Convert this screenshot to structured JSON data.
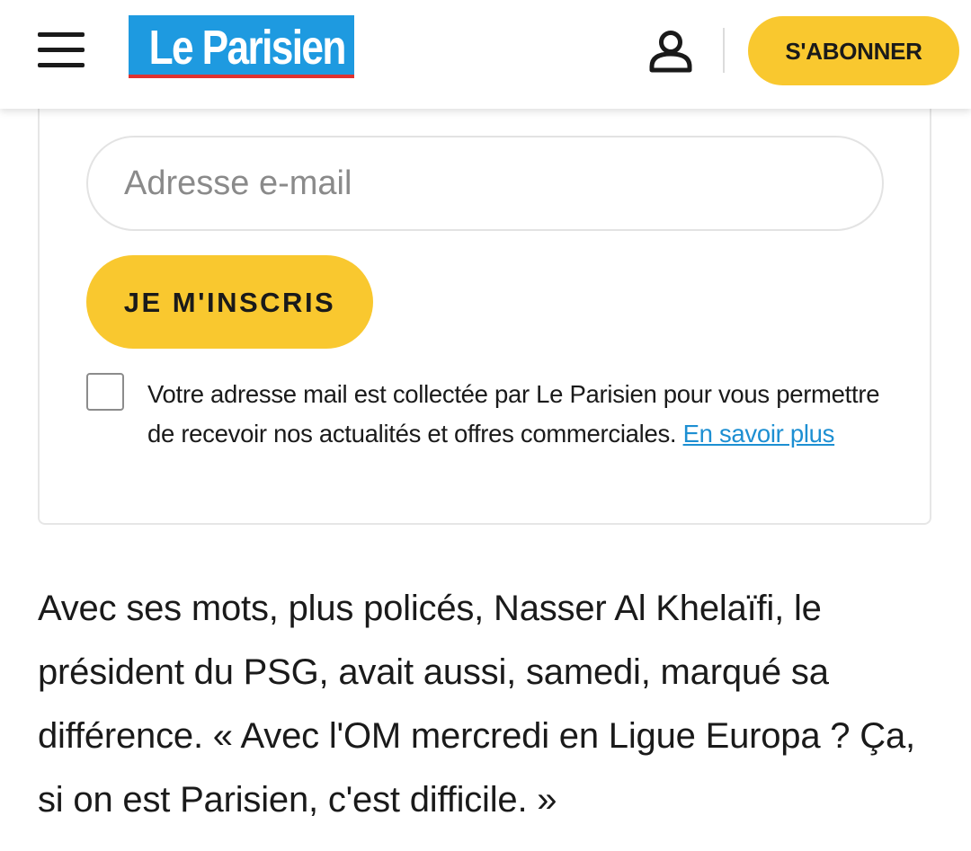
{
  "header": {
    "logo_text": "Le Parisien",
    "subscribe_label": "S'ABONNER",
    "menu_icon": "hamburger-menu-icon",
    "account_icon": "user-account-icon"
  },
  "newsletter": {
    "email_placeholder": "Adresse e-mail",
    "signup_label": "JE M'INSCRIS",
    "consent_text": "Votre adresse mail est collectée par Le Parisien pour vous permettre de recevoir nos actualités et offres commerciales. ",
    "consent_link": "En savoir plus"
  },
  "article": {
    "paragraph": "Avec ses mots, plus policés, Nasser Al Khelaïfi, le président du PSG, avait aussi, samedi, marqué sa différence. « Avec l'OM mercredi en Ligue Europa ? Ça, si on est Parisien, c'est difficile. »"
  },
  "colors": {
    "brand_blue": "#1e9ae0",
    "brand_red": "#e0322f",
    "accent_yellow": "#f9c82f",
    "link_blue": "#1d8fd2"
  }
}
